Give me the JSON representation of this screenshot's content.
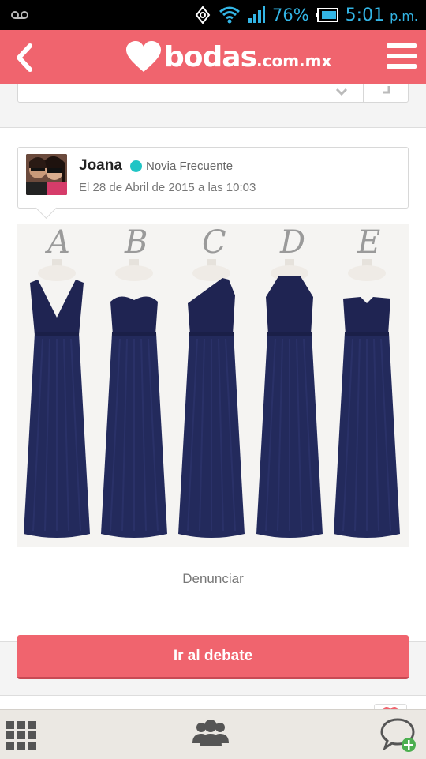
{
  "status_bar": {
    "battery_percent": "76%",
    "time": "5:01",
    "time_suffix": "p.m.",
    "icons": [
      "voicemail-icon",
      "sync-icon",
      "wifi-icon",
      "signal-icon",
      "battery-icon"
    ],
    "color": "#33b5e5"
  },
  "header": {
    "logo_text": "bodas",
    "logo_domain": ".com.mx",
    "icons": [
      "back-arrow-icon",
      "heart-logo-icon",
      "hamburger-menu-icon"
    ],
    "color": "#f0646e"
  },
  "post": {
    "author_name": "Joana",
    "author_rank": "Novia Frecuente",
    "online_status_color": "#20c5c5",
    "date": "El 28 de Abril de 2015 a las 10:03",
    "image_labels": [
      "A",
      "B",
      "C",
      "D",
      "E"
    ],
    "report_label": "Denunciar"
  },
  "cta": {
    "label": "Ir al debate"
  },
  "bottom_nav": {
    "icons": [
      "grid-menu-icon",
      "community-icon",
      "new-chat-icon"
    ]
  }
}
